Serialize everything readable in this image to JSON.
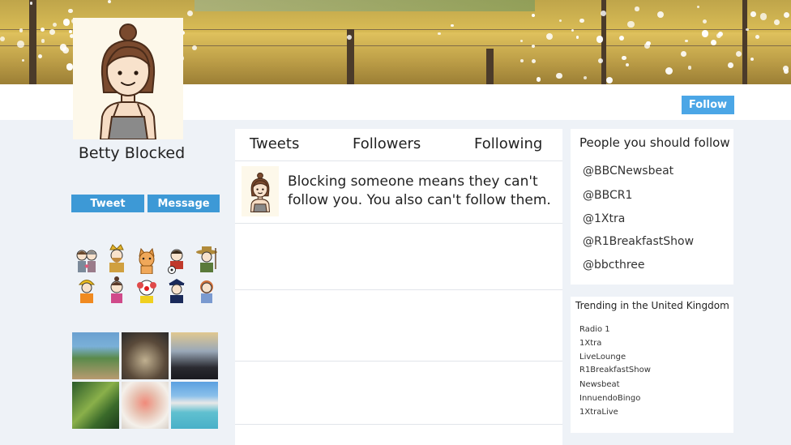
{
  "header": {
    "follow_label": "Follow"
  },
  "profile": {
    "name": "Betty Blocked",
    "tweet_label": "Tweet",
    "message_label": "Message"
  },
  "tabs": [
    {
      "label": "Tweets"
    },
    {
      "label": "Followers"
    },
    {
      "label": "Following"
    }
  ],
  "tweet": {
    "text": "Blocking someone means they can't follow you. You also can't follow them."
  },
  "suggestions": {
    "title": "People you should follow",
    "items": [
      "@BBCNewsbeat",
      "@BBCR1",
      "@1Xtra",
      "@R1BreakfastShow",
      "@bbcthree"
    ]
  },
  "trending": {
    "title": "Trending in the United Kingdom",
    "items": [
      "Radio 1",
      "1Xtra",
      "LiveLounge",
      "R1BreakfastShow",
      "Newsbeat",
      "InnuendoBingo",
      "1XtraLive"
    ]
  },
  "colors": {
    "accent": "#3d99d6",
    "follow": "#4ba6e6",
    "page_bg": "#eef2f7"
  }
}
